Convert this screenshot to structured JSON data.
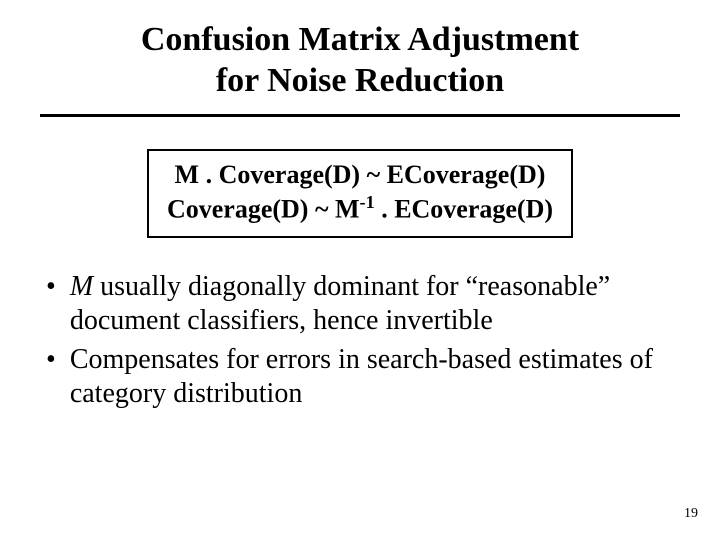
{
  "title": {
    "line1": "Confusion Matrix Adjustment",
    "line2": "for Noise Reduction"
  },
  "formula": {
    "line1_a": "M . Coverage(D) ~ ECoverage(D)",
    "line2_a": "Coverage(D) ~ M",
    "line2_sup": "-1",
    "line2_b": " . ECoverage(D)"
  },
  "bullets": [
    {
      "italic_lead": "M",
      "rest": " usually diagonally dominant for “reasonable” document classifiers, hence invertible"
    },
    {
      "italic_lead": "",
      "rest": "Compensates for errors in search-based estimates of category distribution"
    }
  ],
  "page_number": "19"
}
